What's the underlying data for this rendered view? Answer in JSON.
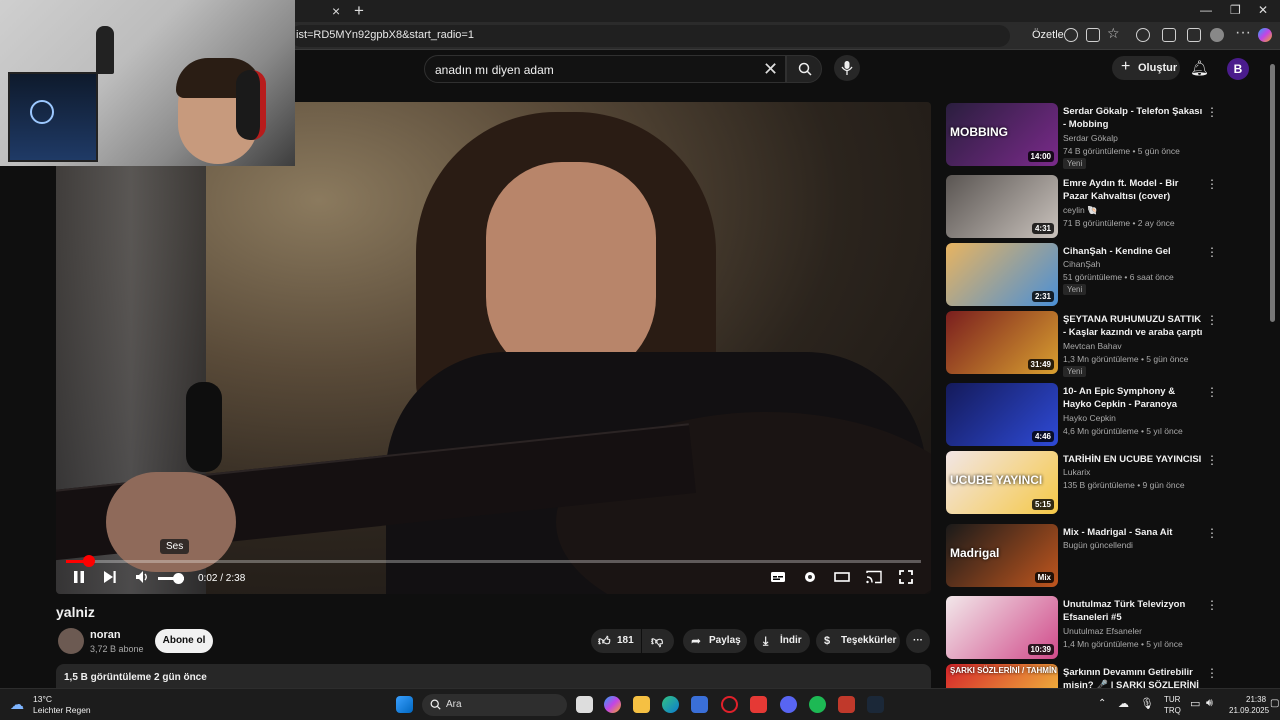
{
  "browser": {
    "url": "ist=RD5MYn92gpbX8&start_radio=1",
    "summarize_label": "Özetle",
    "tab_close": "×",
    "tab_new": "+"
  },
  "header": {
    "search_value": "anadın mı diyen adam",
    "create_label": "Oluştur",
    "avatar_letter": "B"
  },
  "player": {
    "time_current": "0:02",
    "time_total": "2:38",
    "time_display": "0:02 / 2:38",
    "volume_tooltip": "Ses",
    "progress_fraction": 0.013,
    "volume_fraction": 0.75
  },
  "video": {
    "title": "yalniz",
    "channel": "noran",
    "subscribers": "3,72 B abone",
    "subscribe_label": "Abone ol",
    "likes": "181",
    "share_label": "Paylaş",
    "download_label": "İndir",
    "thanks_label": "Teşekkürler",
    "views_date": "1,5 B görüntüleme  2 gün önce"
  },
  "recommendations": [
    {
      "title": "Serdar Gökalp - Telefon Şakası - Mobbing",
      "channel": "Serdar Gökalp",
      "meta": "74 B görüntüleme • 5 gün önce",
      "badge": "Yeni",
      "duration": "14:00",
      "thumb_text": "MOBBING",
      "colors": [
        "#2a1e3e",
        "#7a2a8a"
      ]
    },
    {
      "title": "Emre Aydın ft. Model - Bir Pazar Kahvaltısı (cover)",
      "channel": "ceylin 🐚",
      "meta": "71 B görüntüleme • 2 ay önce",
      "badge": "",
      "duration": "4:31",
      "thumb_text": "",
      "colors": [
        "#5a5552",
        "#c9c2bc"
      ]
    },
    {
      "title": "CihanŞah -  Kendine  Gel",
      "channel": "CihanŞah",
      "meta": "51 görüntüleme • 6 saat önce",
      "badge": "Yeni",
      "duration": "2:31",
      "thumb_text": "",
      "colors": [
        "#e8b460",
        "#4a8fd6"
      ]
    },
    {
      "title": "ŞEYTANA RUHUMUZU SATTIK - Kaşlar kazındı ve araba çarptı ...",
      "channel": "Mevtcan Bahav",
      "meta": "1,3 Mn görüntüleme • 5 gün önce",
      "badge": "Yeni",
      "duration": "31:49",
      "thumb_text": "",
      "colors": [
        "#7a1e1e",
        "#d9a030"
      ]
    },
    {
      "title": "10- An Epic Symphony & Hayko Cepkin - Paranoya",
      "channel": "Hayko Cepkin",
      "meta": "4,6 Mn görüntüleme • 5 yıl önce",
      "badge": "",
      "duration": "4:46",
      "thumb_text": "",
      "colors": [
        "#141a5a",
        "#2e4ad6"
      ]
    },
    {
      "title": "TARİHİN EN UCUBE YAYINCISI",
      "channel": "Lukarix",
      "meta": "135 B görüntüleme • 9 gün önce",
      "badge": "",
      "duration": "5:15",
      "thumb_text": "UCUBE YAYINCI",
      "colors": [
        "#f2e6e6",
        "#f5c846"
      ]
    },
    {
      "title": "Mix - Madrigal - Sana Ait",
      "channel": "Bugün güncellendi",
      "meta": "",
      "badge": "",
      "duration": "Mix",
      "thumb_text": "Madrigal",
      "colors": [
        "#1a1a1a",
        "#c0561e"
      ]
    },
    {
      "title": "Unutulmaz Türk Televizyon Efsaneleri #5",
      "channel": "Unutulmaz Efsaneler",
      "meta": "1,4 Mn görüntüleme • 5 yıl önce",
      "badge": "",
      "duration": "10:39",
      "thumb_text": "",
      "colors": [
        "#f2e8ea",
        "#d04a8a"
      ]
    },
    {
      "title": "Şarkının Devamını Getirebilir misin? 🎤 | ŞARKI SÖZLERİNİ ...",
      "channel": "",
      "meta": "",
      "badge": "",
      "duration": "",
      "thumb_text": "ŞARKI SÖZLERİNİ / TAHMİN ET",
      "colors": [
        "#d4242a",
        "#f5d040"
      ]
    }
  ],
  "taskbar": {
    "temperature": "13°C",
    "weather": "Leichter Regen",
    "search_placeholder": "Ara",
    "lang1": "TUR",
    "lang2": "TRQ",
    "time": "21:38",
    "date": "21.09.2025"
  },
  "colors": {
    "accent_red": "#ff0000",
    "bg": "#0f0f0f",
    "pill": "#272727"
  }
}
